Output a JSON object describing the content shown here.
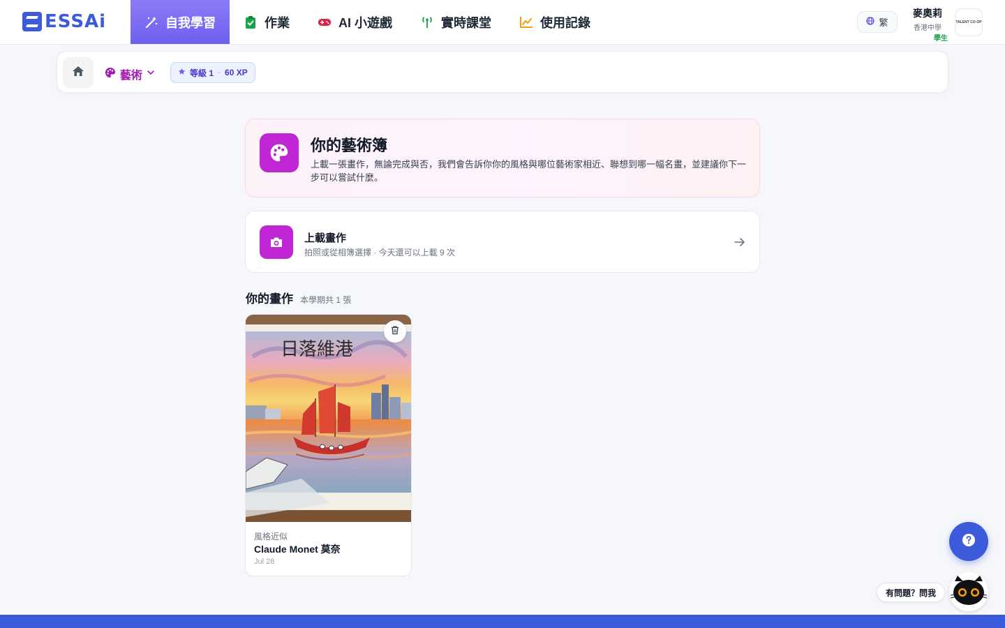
{
  "brand": {
    "name": "ESSAi"
  },
  "nav": {
    "tabs": [
      {
        "label": "自我學習",
        "icon": "magic-wand-icon",
        "active": true
      },
      {
        "label": "作業",
        "icon": "clipboard-check-icon"
      },
      {
        "label": "AI 小遊戲",
        "icon": "gamepad-icon"
      },
      {
        "label": "實時課堂",
        "icon": "broadcast-icon"
      },
      {
        "label": "使用記錄",
        "icon": "line-chart-icon"
      }
    ],
    "language": "繁",
    "user": {
      "name": "麥奧莉",
      "school": "香港中學",
      "role": "學生",
      "logo_text": "TALENT CO-OP"
    }
  },
  "subbar": {
    "subject": "藝術",
    "level": "等級 1",
    "xp": "60 XP"
  },
  "intro": {
    "title": "你的藝術簿",
    "description": "上載一張畫作，無論完成與否，我們會告訴你你的風格與哪位藝術家相近、聯想到哪一幅名畫，並建議你下一步可以嘗試什麼。"
  },
  "upload": {
    "title": "上載畫作",
    "subtitle": "拍照或從相簿選擇 · 今天還可以上載 9 次"
  },
  "works": {
    "heading": "你的畫作",
    "count_label": "本學期共 1 張",
    "items": [
      {
        "artwork_title_text": "日落維港",
        "style_label": "風格近似",
        "artist": "Claude Monet 莫奈",
        "date": "Jul 28"
      }
    ]
  },
  "floating": {
    "ask_label": "有問題？問我"
  },
  "colors": {
    "primary": "#3b5bdb",
    "active_tab": "#7c6cf2",
    "art_accent": "#c026d3",
    "xp_badge": "#4338ca"
  }
}
